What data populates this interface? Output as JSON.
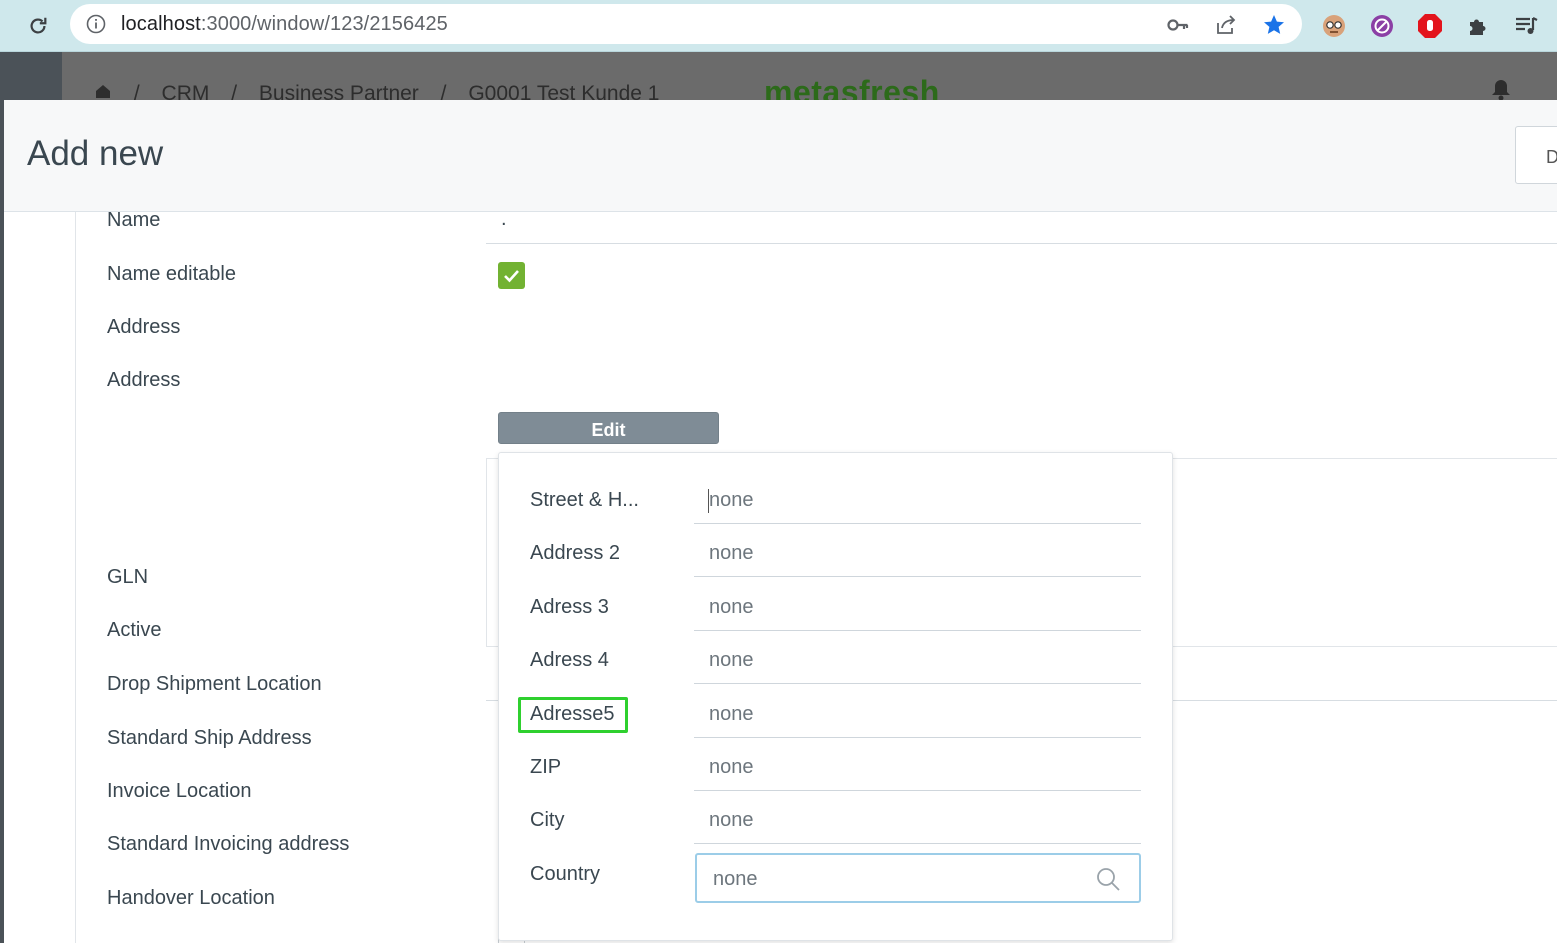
{
  "browser": {
    "url_host": "localhost",
    "url_path": ":3000/window/123/2156425",
    "icons": [
      "reload-icon",
      "info-icon",
      "key-icon",
      "share-icon",
      "star-icon",
      "extension-face-icon",
      "extension-block-icon",
      "extension-hand-icon",
      "puzzle-icon",
      "media-icon"
    ]
  },
  "app": {
    "breadcrumbs": [
      "/",
      "CRM",
      "/",
      "Business Partner",
      "/",
      "G0001 Test Kunde 1"
    ],
    "brand": "metasfresh"
  },
  "modal": {
    "title": "Add new",
    "action_label": "D"
  },
  "form": {
    "name_label": "Name",
    "name_value": ".",
    "name_editable_label": "Name editable",
    "address_label": "Address",
    "edit_button": "Edit",
    "address2_label": "Address",
    "gln_label": "GLN",
    "active_label": "Active",
    "drop_shipment_label": "Drop Shipment Location",
    "standard_ship_label": "Standard Ship Address",
    "invoice_location_label": "Invoice Location",
    "standard_invoicing_label": "Standard Invoicing address",
    "handover_label": "Handover Location",
    "checkboxes": {
      "name_editable": true,
      "standard_invoicing": false,
      "handover": true
    }
  },
  "address_popup": {
    "fields": [
      {
        "label": "Street & H...",
        "value": "none"
      },
      {
        "label": "Address 2",
        "value": "none"
      },
      {
        "label": "Adress 3",
        "value": "none"
      },
      {
        "label": "Adress 4",
        "value": "none"
      },
      {
        "label": "Adresse5",
        "value": "none"
      },
      {
        "label": "ZIP",
        "value": "none"
      },
      {
        "label": "City",
        "value": "none"
      }
    ],
    "country_label": "Country",
    "country_value": "none",
    "highlight_color": "#2fd02f",
    "accent_color": "#72b232"
  }
}
